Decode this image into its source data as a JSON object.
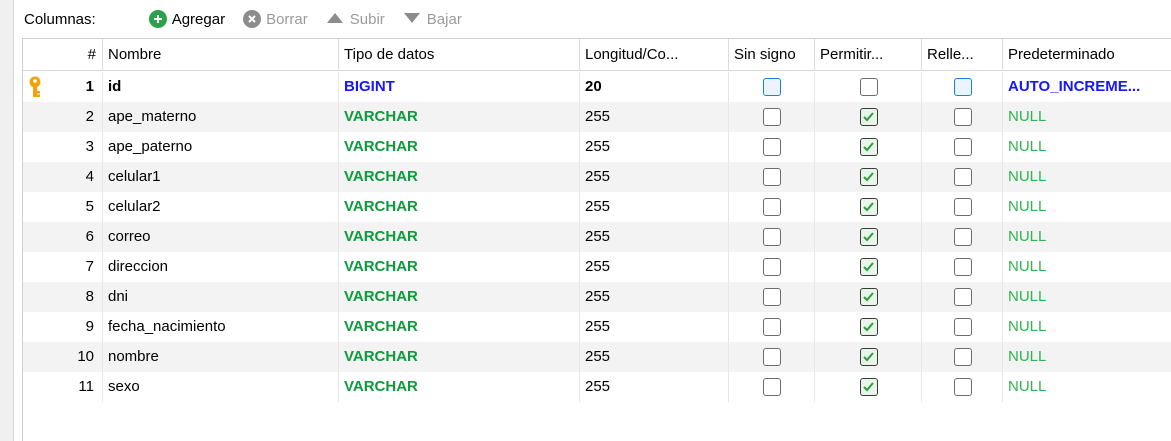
{
  "toolbar": {
    "label": "Columnas:",
    "add_label": "Agregar",
    "delete_label": "Borrar",
    "up_label": "Subir",
    "down_label": "Bajar"
  },
  "columns": {
    "num": "#",
    "name": "Nombre",
    "type": "Tipo de datos",
    "length": "Longitud/Co...",
    "unsigned": "Sin signo",
    "allow_null": "Permitir...",
    "zerofill": "Relle...",
    "default": "Predeterminado"
  },
  "rows": [
    {
      "num": "1",
      "name": "id",
      "type": "BIGINT",
      "length": "20",
      "unsigned": false,
      "allow_null": false,
      "zerofill": false,
      "default": "AUTO_INCREME...",
      "primary_key": true
    },
    {
      "num": "2",
      "name": "ape_materno",
      "type": "VARCHAR",
      "length": "255",
      "unsigned": false,
      "allow_null": true,
      "zerofill": false,
      "default": "NULL"
    },
    {
      "num": "3",
      "name": "ape_paterno",
      "type": "VARCHAR",
      "length": "255",
      "unsigned": false,
      "allow_null": true,
      "zerofill": false,
      "default": "NULL"
    },
    {
      "num": "4",
      "name": "celular1",
      "type": "VARCHAR",
      "length": "255",
      "unsigned": false,
      "allow_null": true,
      "zerofill": false,
      "default": "NULL"
    },
    {
      "num": "5",
      "name": "celular2",
      "type": "VARCHAR",
      "length": "255",
      "unsigned": false,
      "allow_null": true,
      "zerofill": false,
      "default": "NULL"
    },
    {
      "num": "6",
      "name": "correo",
      "type": "VARCHAR",
      "length": "255",
      "unsigned": false,
      "allow_null": true,
      "zerofill": false,
      "default": "NULL"
    },
    {
      "num": "7",
      "name": "direccion",
      "type": "VARCHAR",
      "length": "255",
      "unsigned": false,
      "allow_null": true,
      "zerofill": false,
      "default": "NULL"
    },
    {
      "num": "8",
      "name": "dni",
      "type": "VARCHAR",
      "length": "255",
      "unsigned": false,
      "allow_null": true,
      "zerofill": false,
      "default": "NULL"
    },
    {
      "num": "9",
      "name": "fecha_nacimiento",
      "type": "VARCHAR",
      "length": "255",
      "unsigned": false,
      "allow_null": true,
      "zerofill": false,
      "default": "NULL"
    },
    {
      "num": "10",
      "name": "nombre",
      "type": "VARCHAR",
      "length": "255",
      "unsigned": false,
      "allow_null": true,
      "zerofill": false,
      "default": "NULL"
    },
    {
      "num": "11",
      "name": "sexo",
      "type": "VARCHAR",
      "length": "255",
      "unsigned": false,
      "allow_null": true,
      "zerofill": false,
      "default": "NULL"
    }
  ],
  "colors": {
    "type_varchar": "#0c9b3c",
    "type_bigint": "#1616ff",
    "default_null": "#2fb34f",
    "default_auto": "#1616ff",
    "add_icon": "#2aa14a",
    "key_icon": "#f2a20c"
  },
  "icons": {
    "add": "plus-circle-icon",
    "delete": "x-circle-icon",
    "up": "triangle-up-icon",
    "down": "triangle-down-icon",
    "primary_key": "key-icon"
  }
}
